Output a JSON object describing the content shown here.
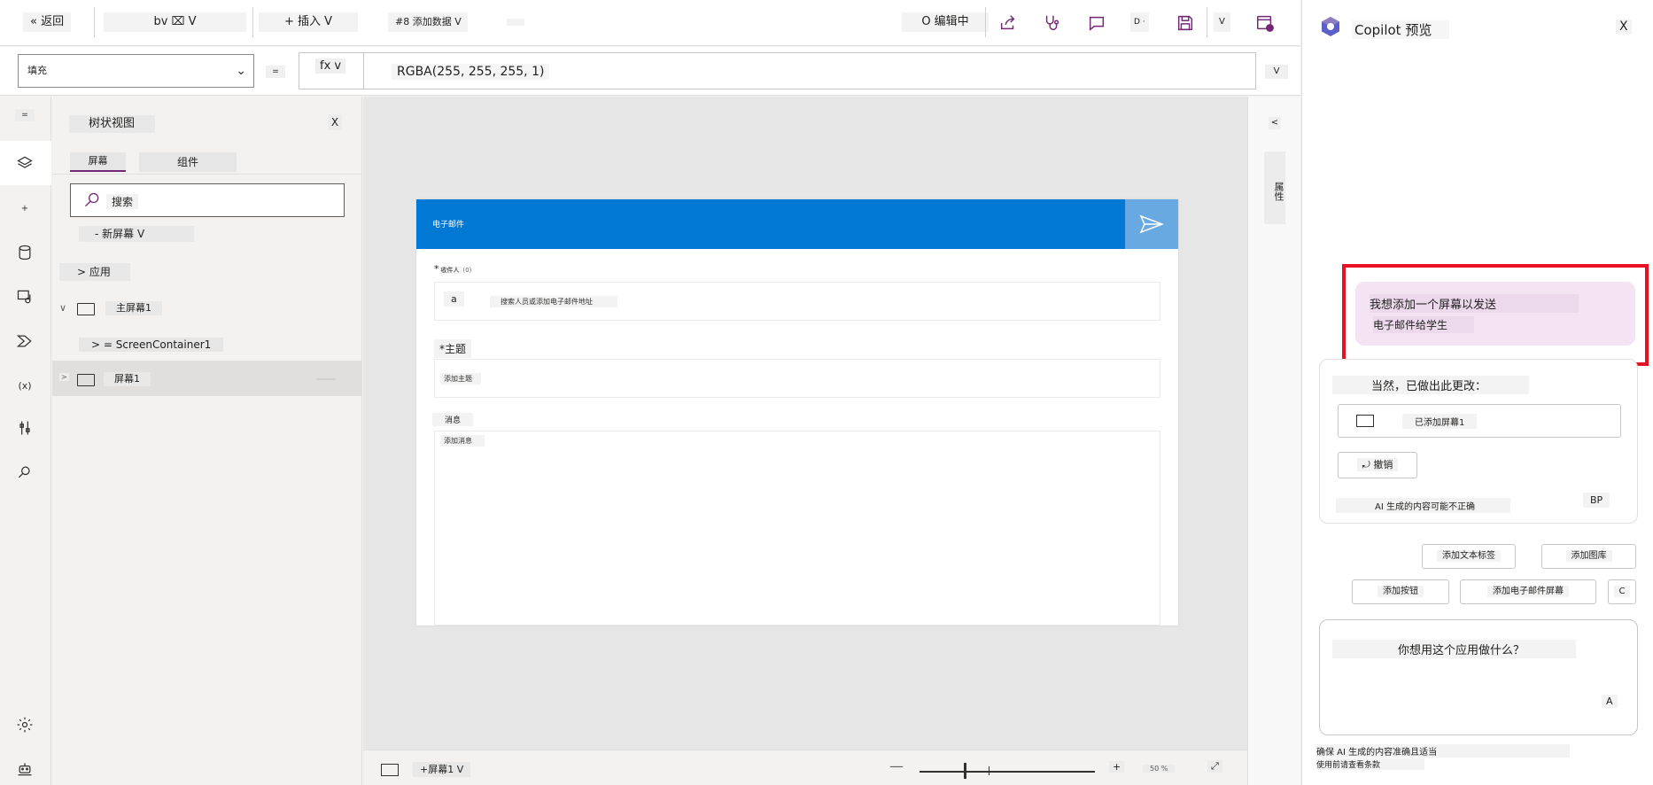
{
  "topbar": {
    "back_label": "« 返回",
    "undo_label": "bv ⌧ V",
    "insert_label": "+ 插入 V",
    "add_data_label": "#8 添加数据 V",
    "editing_label": "O 编辑中",
    "d_label": "D ·",
    "v_label": "V"
  },
  "formula": {
    "property": "填充",
    "eq": "=",
    "fx_label": "fx v",
    "value": "RGBA(255, 255, 255, 1)",
    "expand": "V"
  },
  "rail": {
    "menu": "=",
    "insert": "+",
    "variables": "(x)"
  },
  "tree": {
    "title": "树状视图",
    "close": "X",
    "tab_screens": "屏幕",
    "tab_components": "组件",
    "search_placeholder": "搜索",
    "new_screen": "- 新屏幕 V",
    "app": "> 应用",
    "rows": [
      {
        "caret": "∨",
        "label": "主屏幕1"
      },
      {
        "caret": "",
        "label": "> = ScreenContainer1"
      },
      {
        "caret": ">",
        "label": "屏幕1"
      }
    ]
  },
  "canvas": {
    "header_title": "电子邮件",
    "to_label": "*",
    "to_label_text": "收件人",
    "to_label_tiny": "(0)",
    "to_avatar": "a",
    "to_placeholder": "搜索人员或添加电子邮件地址",
    "subject_label": "*主题",
    "subject_placeholder": "添加主题",
    "message_label": "消息",
    "message_placeholder": "添加消息"
  },
  "prop_rail": {
    "collapse": "<",
    "vertical_label": "属性"
  },
  "status": {
    "screen": "+屏幕1 V",
    "minus": "—",
    "plus": "+",
    "zoom": "50 %",
    "fit": "⤢"
  },
  "copilot": {
    "title": "Copilot 预览",
    "close": "X",
    "user_message_line1": "我想添加一个屏幕以发送",
    "user_message_line2": "电子邮件给学生",
    "reply_head": "当然，已做出此更改：",
    "added_item": "已添加屏幕1",
    "undo": "⤾ 撤销",
    "disclaimer": "AI 生成的内容可能不正确",
    "feedback": "BP",
    "chips": [
      "添加文本标签",
      "添加图库",
      "添加按钮",
      "添加电子邮件屏幕",
      "C"
    ],
    "input_placeholder": "你想用这个应用做什么？",
    "send": "A",
    "footer_line1": "确保 AI 生成的内容准确且适当",
    "footer_line2": "使用前请查看条款"
  },
  "colors": {
    "accent": "#742774",
    "header_blue": "#0078d4",
    "send_blue": "#69a9e2",
    "highlight_red": "#e81123",
    "user_bubble": "#f3e3f3"
  }
}
